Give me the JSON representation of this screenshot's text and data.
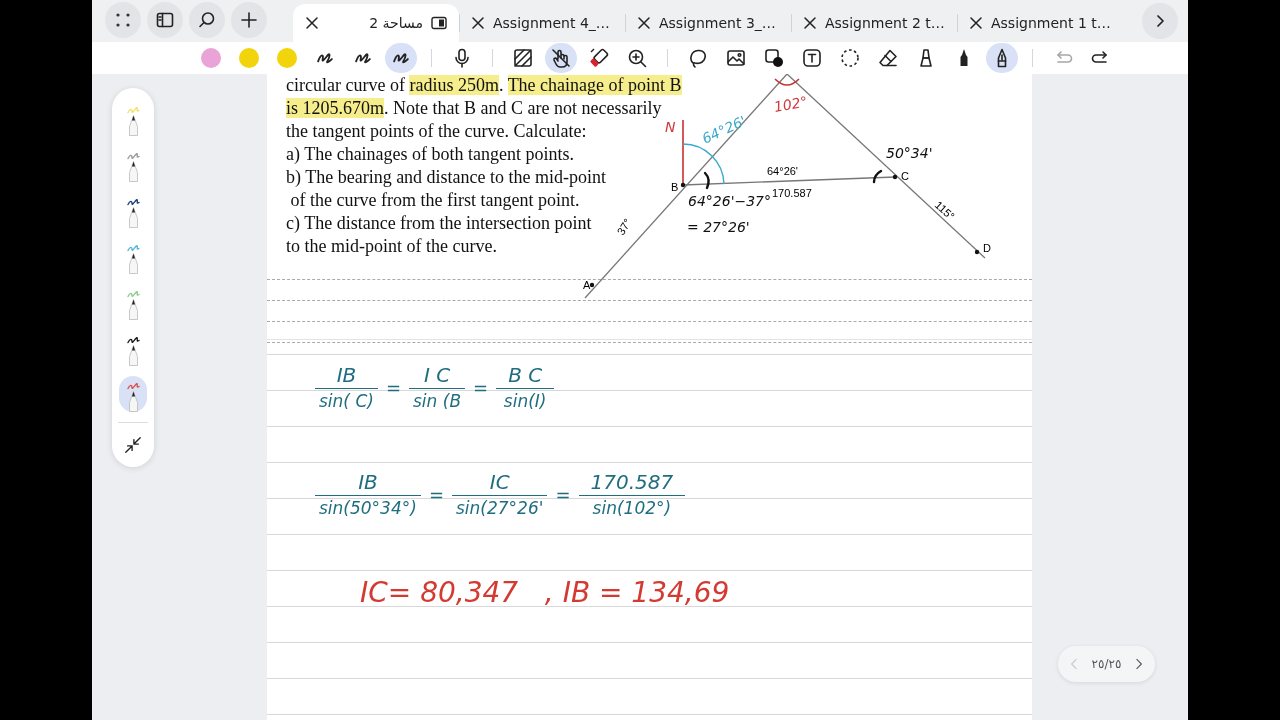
{
  "tab_bar": {
    "buttons": [
      {
        "kind": "grid"
      },
      {
        "kind": "sidebar"
      },
      {
        "kind": "search"
      },
      {
        "kind": "plus"
      }
    ],
    "tabs": [
      {
        "label": "مساحة 2",
        "selected": true
      },
      {
        "label": "Assignment 4_…",
        "selected": false
      },
      {
        "label": "Assignment 3_…",
        "selected": false
      },
      {
        "label": "Assignment 2 t…",
        "selected": false
      },
      {
        "label": "Assignment 1 t…",
        "selected": false
      }
    ]
  },
  "toolbar": {
    "groups": [
      [
        {
          "kind": "color",
          "color": "#e9a3d6",
          "selected": false
        },
        {
          "kind": "color",
          "color": "#f2d40c",
          "selected": false
        },
        {
          "kind": "color",
          "color": "#f2d40c",
          "selected": false
        },
        {
          "kind": "scribble",
          "selected": false
        },
        {
          "kind": "scribble",
          "selected": false
        },
        {
          "kind": "scribble",
          "selected": true
        }
      ],
      [
        {
          "kind": "microphone",
          "selected": false
        }
      ],
      [
        {
          "kind": "hatch",
          "selected": false
        },
        {
          "kind": "hand-slash",
          "selected": true
        },
        {
          "kind": "marker",
          "selected": false
        },
        {
          "kind": "zoom-in",
          "selected": false
        }
      ],
      [
        {
          "kind": "lasso",
          "selected": false
        },
        {
          "kind": "image",
          "selected": false
        },
        {
          "kind": "shape",
          "selected": false
        },
        {
          "kind": "text-box",
          "selected": false
        },
        {
          "kind": "dashed-circle",
          "selected": false
        },
        {
          "kind": "eraser",
          "selected": false
        },
        {
          "kind": "highlighter",
          "selected": false
        },
        {
          "kind": "fountain-pen",
          "selected": false
        },
        {
          "kind": "pen",
          "selected": true
        }
      ],
      [
        {
          "kind": "undo",
          "disabled": true
        },
        {
          "kind": "redo",
          "disabled": false
        }
      ]
    ]
  },
  "pen_palette": {
    "pens": [
      {
        "color": "#f0e26a",
        "selected": false
      },
      {
        "color": "#9a9a9a",
        "selected": false
      },
      {
        "color": "#1c3f73",
        "selected": false
      },
      {
        "color": "#58b9d9",
        "selected": false
      },
      {
        "color": "#8ccc88",
        "selected": false
      },
      {
        "color": "#1a1a1a",
        "selected": false
      },
      {
        "color": "#d9534f",
        "selected": true
      }
    ]
  },
  "problem": {
    "lines": [
      [
        {
          "text": "circular curve of ",
          "highlighted": false
        },
        {
          "text": "radius 250m",
          "highlighted": true
        },
        {
          "text": ". ",
          "highlighted": false
        },
        {
          "text": "The chainage of point B",
          "highlighted": true
        }
      ],
      [
        {
          "text": "is 1205.670m",
          "highlighted": true
        },
        {
          "text": ". Note that B and C are not necessarily",
          "highlighted": false
        }
      ],
      [
        {
          "text": "the tangent points of the curve. Calculate:",
          "highlighted": false
        }
      ],
      [
        {
          "text": "a) The chainages of both tangent points.",
          "highlighted": false
        }
      ],
      [
        {
          "text": "b) The bearing and distance to the mid-point",
          "highlighted": false
        }
      ],
      [
        {
          "text": " of the curve from the first tangent point.",
          "highlighted": false
        }
      ],
      [
        {
          "text": "c) The distance from the intersection point",
          "highlighted": false
        }
      ],
      [
        {
          "text": "to the mid-point of the curve.",
          "highlighted": false
        }
      ]
    ]
  },
  "diagram": {
    "labels": [
      {
        "text": "N",
        "kind": "handwritten",
        "color": "#d03a3a"
      },
      {
        "text": "64°26'",
        "kind": "handwritten",
        "color": "#3aa8d0"
      },
      {
        "text": "102°",
        "kind": "handwritten",
        "color": "#d03a3a"
      },
      {
        "text": "50°34'",
        "kind": "handwritten",
        "color": "#111111"
      },
      {
        "text": "B",
        "kind": "printed"
      },
      {
        "text": "64°26'",
        "kind": "printed"
      },
      {
        "text": "C",
        "kind": "printed"
      },
      {
        "text": "170.587",
        "kind": "printed"
      },
      {
        "text": "64°26'−37°",
        "kind": "handwritten",
        "color": "#111111"
      },
      {
        "text": "= 27°26'",
        "kind": "handwritten",
        "color": "#111111"
      },
      {
        "text": "37°",
        "kind": "printed"
      },
      {
        "text": "115°",
        "kind": "printed"
      },
      {
        "text": "D",
        "kind": "printed"
      },
      {
        "text": "A",
        "kind": "printed"
      }
    ]
  },
  "notes": [
    {
      "kind": "fractions",
      "color": "#1f6e80",
      "terms": [
        {
          "numerator": "IB",
          "denominator": "sin( C)"
        },
        {
          "sign": "=",
          "numerator": "I C",
          "denominator": "sin (B"
        },
        {
          "sign": "=",
          "numerator": "B C",
          "denominator": "sin(I)"
        }
      ]
    },
    {
      "kind": "fractions",
      "color": "#1f6e80",
      "terms": [
        {
          "numerator": "IB",
          "denominator": "sin(50°34°)"
        },
        {
          "sign": "=",
          "numerator": "IC",
          "denominator": "sin(27°26'"
        },
        {
          "sign": "=",
          "numerator": "170.587",
          "denominator": "sin(102°)"
        }
      ]
    },
    {
      "kind": "text",
      "color": "#d23a32",
      "text": "IC= 80,347   , IB = 134,69"
    }
  ],
  "page_indicator": {
    "text": "٢٥/٢٥",
    "prev_disabled": true
  }
}
